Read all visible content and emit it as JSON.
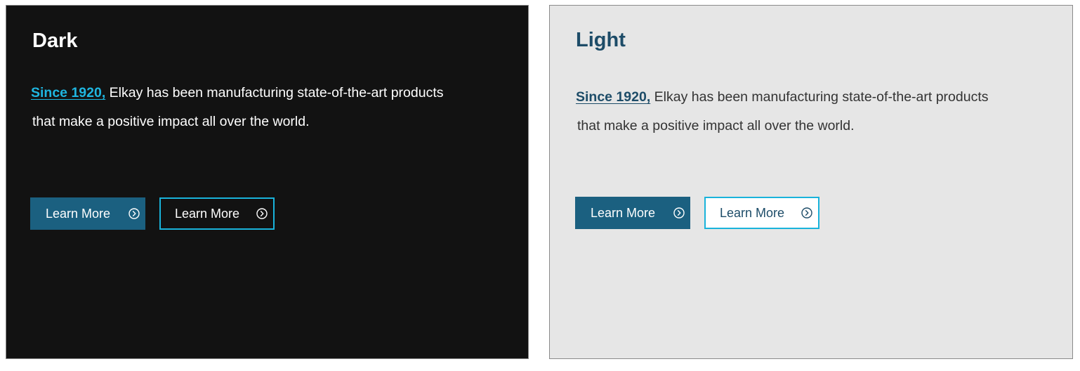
{
  "panels": [
    {
      "title": "Dark",
      "since_link": "Since 1920,",
      "text_line1": " Elkay has been manufacturing state-of-the-art products",
      "text_line2": "that make a positive impact all over the world.",
      "primary_button": "Learn More",
      "secondary_button": "Learn More"
    },
    {
      "title": "Light",
      "since_link": "Since 1920,",
      "text_line1": " Elkay has been manufacturing state-of-the-art products",
      "text_line2": "that make a positive impact all over the world.",
      "primary_button": "Learn More",
      "secondary_button": "Learn More"
    }
  ],
  "colors": {
    "dark_background": "#121212",
    "light_background": "#e6e6e6",
    "accent_cyan": "#19b3db",
    "button_blue": "#1b6080",
    "title_navy": "#1d4c68"
  },
  "icons": {
    "button_icon": "chevron-right-circle-icon"
  }
}
